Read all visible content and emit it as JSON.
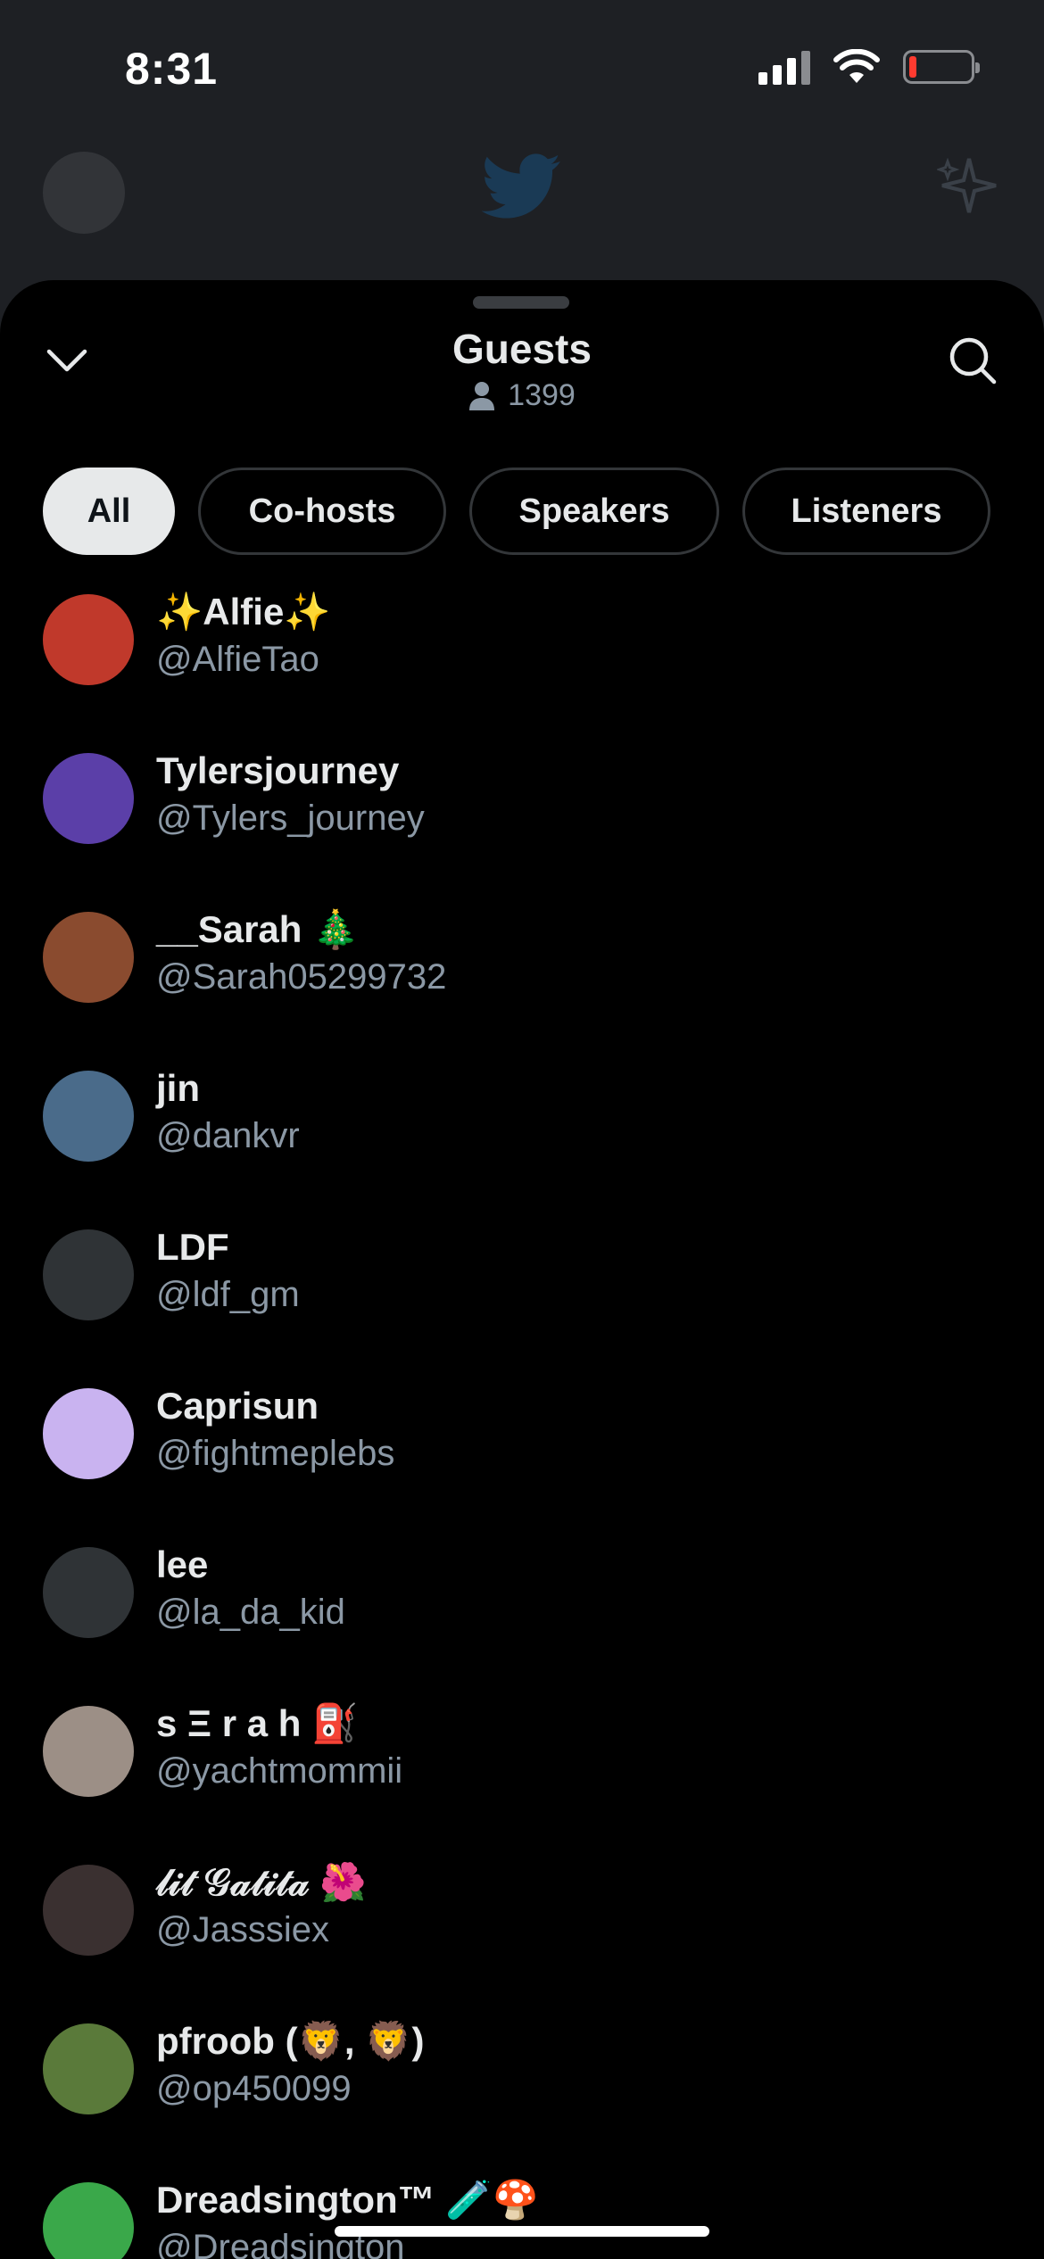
{
  "status_bar": {
    "time": "8:31"
  },
  "sheet": {
    "title": "Guests",
    "count": "1399"
  },
  "filters": [
    {
      "label": "All",
      "active": true
    },
    {
      "label": "Co-hosts",
      "active": false
    },
    {
      "label": "Speakers",
      "active": false
    },
    {
      "label": "Listeners",
      "active": false
    }
  ],
  "guests": [
    {
      "name": "✨Alfie✨",
      "handle": "@AlfieTao",
      "avatar_color": "#c0392b"
    },
    {
      "name": "Tylersjourney",
      "handle": "@Tylers_journey",
      "avatar_color": "#5b3fa8"
    },
    {
      "name": "__Sarah 🎄",
      "handle": "@Sarah05299732",
      "avatar_color": "#8a4b2f"
    },
    {
      "name": "jin",
      "handle": "@dankvr",
      "avatar_color": "#4a6b8a"
    },
    {
      "name": "LDF",
      "handle": "@ldf_gm",
      "avatar_color": "#2f3336"
    },
    {
      "name": "Caprisun",
      "handle": "@fightmeplebs",
      "avatar_color": "#c9b3f0"
    },
    {
      "name": "lee",
      "handle": "@la_da_kid",
      "avatar_color": "#2f3336"
    },
    {
      "name": "s Ξ r a h ⛽",
      "handle": "@yachtmommii",
      "avatar_color": "#9c8f86"
    },
    {
      "name": "𝓁𝒾𝓉 𝒢𝒶𝓉𝒾𝓉𝒶 🌺",
      "handle": "@Jasssiex",
      "avatar_color": "#3a3030"
    },
    {
      "name": "pfroob (🦁, 🦁)",
      "handle": "@op450099",
      "avatar_color": "#5a7a3a"
    },
    {
      "name": "Dreadsington™ 🧪🍄",
      "handle": "@Dreadsington",
      "avatar_color": "#3aa84a"
    }
  ]
}
